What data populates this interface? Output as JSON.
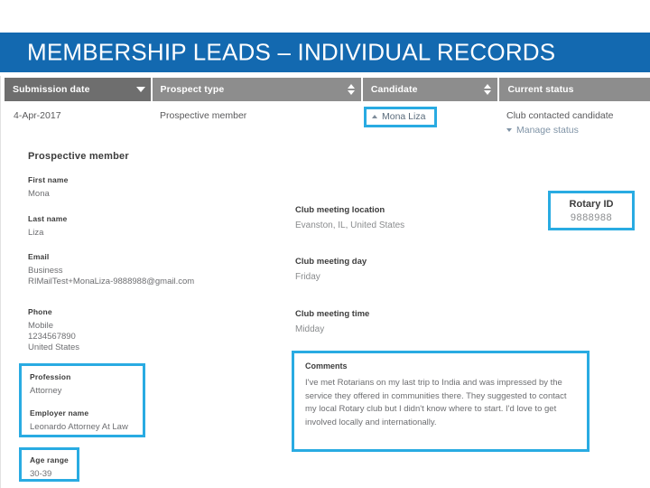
{
  "slide": {
    "title": "MEMBERSHIP LEADS – INDIVIDUAL RECORDS"
  },
  "table": {
    "columns": [
      {
        "label": "Submission date",
        "sort_icon": "caret-down-icon",
        "active": true
      },
      {
        "label": "Prospect type",
        "sort_icon": "sort-both-icon",
        "active": false
      },
      {
        "label": "Candidate",
        "sort_icon": "sort-both-icon",
        "active": false
      },
      {
        "label": "Current status",
        "sort_icon": "none",
        "active": false
      }
    ],
    "row": {
      "submission_date": "4-Apr-2017",
      "prospect_type": "Prospective member",
      "candidate": "Mona Liza",
      "current_status": "Club contacted candidate",
      "manage_status_link": "Manage status"
    }
  },
  "detail": {
    "section_title": "Prospective member",
    "first_name": {
      "label": "First name",
      "value": "Mona"
    },
    "last_name": {
      "label": "Last name",
      "value": "Liza"
    },
    "email": {
      "label": "Email",
      "value": "Business\nRIMailTest+MonaLiza-9888988@gmail.com"
    },
    "phone": {
      "label": "Phone",
      "value": "Mobile\n1234567890\nUnited States"
    },
    "profession": {
      "label": "Profession",
      "value": "Attorney"
    },
    "employer_name": {
      "label": "Employer name",
      "value": "Leonardo Attorney At Law"
    },
    "age_range": {
      "label": "Age range",
      "value": "30-39"
    },
    "club_meeting_location": {
      "label": "Club meeting location",
      "value": "Evanston, IL, United States"
    },
    "club_meeting_day": {
      "label": "Club meeting day",
      "value": "Friday"
    },
    "club_meeting_time": {
      "label": "Club meeting time",
      "value": "Midday"
    },
    "rotary_id": {
      "label": "Rotary ID",
      "value": "9888988"
    },
    "comments": {
      "label": "Comments",
      "value": "I've met Rotarians on my last trip to India and was impressed by the service they offered in communities there. They suggested to contact my local Rotary club but I didn't know where to start. I'd love to get involved locally and internationally."
    }
  },
  "colors": {
    "banner_blue": "#1369b0",
    "highlight_cyan": "#29abe2",
    "header_gray": "#8d8d8d",
    "header_gray_active": "#6e6e6e"
  }
}
